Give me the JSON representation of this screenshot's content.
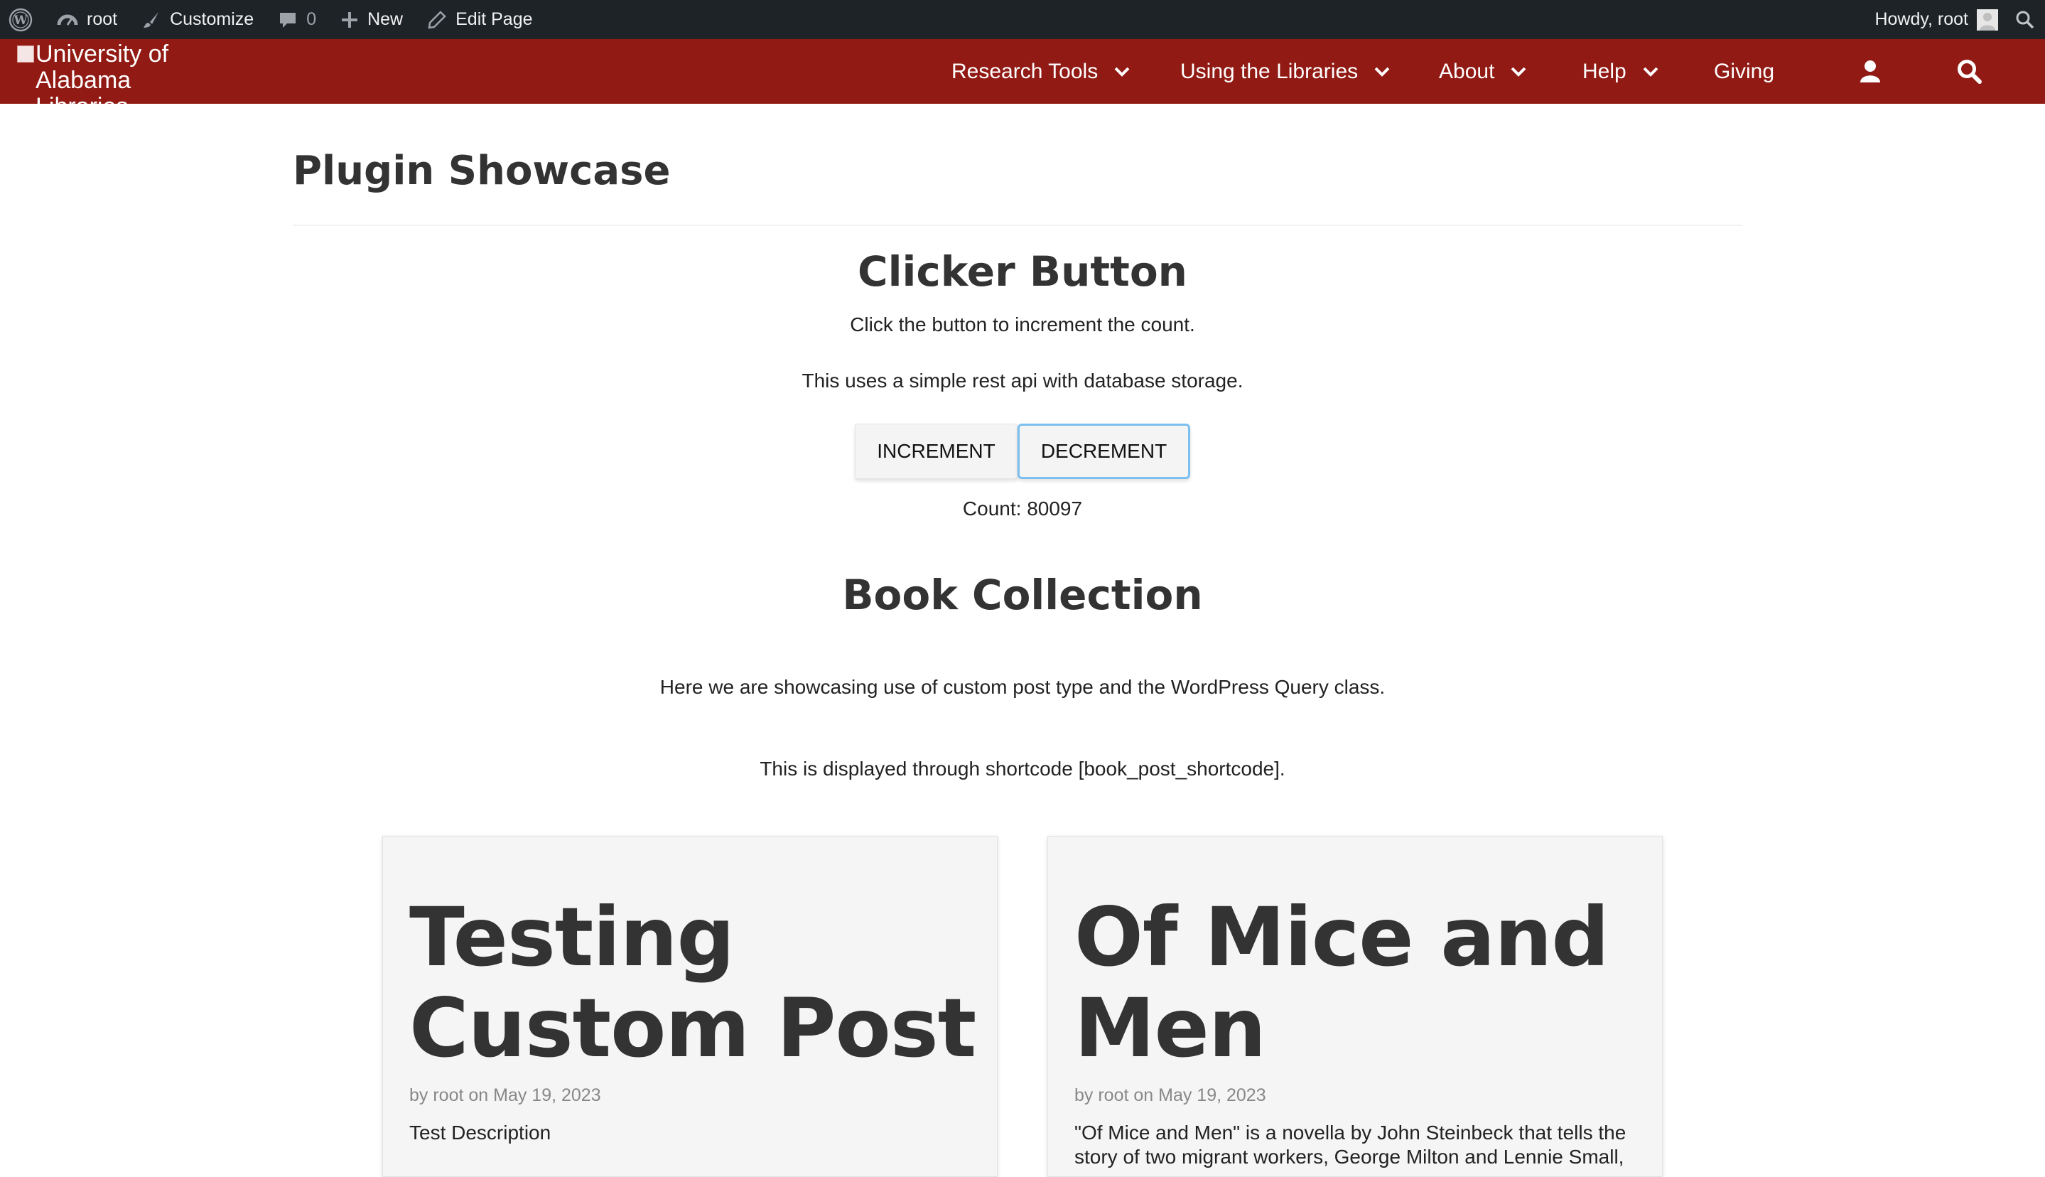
{
  "admin_bar": {
    "site_name": "root",
    "customize": "Customize",
    "comments_count": "0",
    "new": "New",
    "edit_page": "Edit Page",
    "howdy": "Howdy, root"
  },
  "header": {
    "logo_alt": "University of Alabama Libraries",
    "nav": [
      {
        "label": "Research Tools"
      },
      {
        "label": "Using the Libraries"
      },
      {
        "label": "About"
      },
      {
        "label": "Help"
      },
      {
        "label": "Giving"
      }
    ]
  },
  "page": {
    "title": "Plugin Showcase"
  },
  "clicker": {
    "heading": "Clicker Button",
    "line1": "Click the button to increment the count.",
    "line2": "This uses a simple rest api with database storage.",
    "increment_label": "INCREMENT",
    "decrement_label": "DECREMENT",
    "count_text": "Count: 80097"
  },
  "books": {
    "heading": "Book Collection",
    "line1": "Here we are showcasing use of custom post type and the WordPress Query class.",
    "line2": "This is displayed through shortcode [book_post_shortcode].",
    "cards": [
      {
        "title": "Testing Custom Post",
        "meta": "by root on May 19, 2023",
        "description": "Test Description"
      },
      {
        "title": "Of Mice and Men",
        "meta": "by root on May 19, 2023",
        "description": "\"Of Mice and Men\" is a novella by John Steinbeck that tells the story of two migrant workers, George Milton and Lennie Small,"
      }
    ]
  }
}
